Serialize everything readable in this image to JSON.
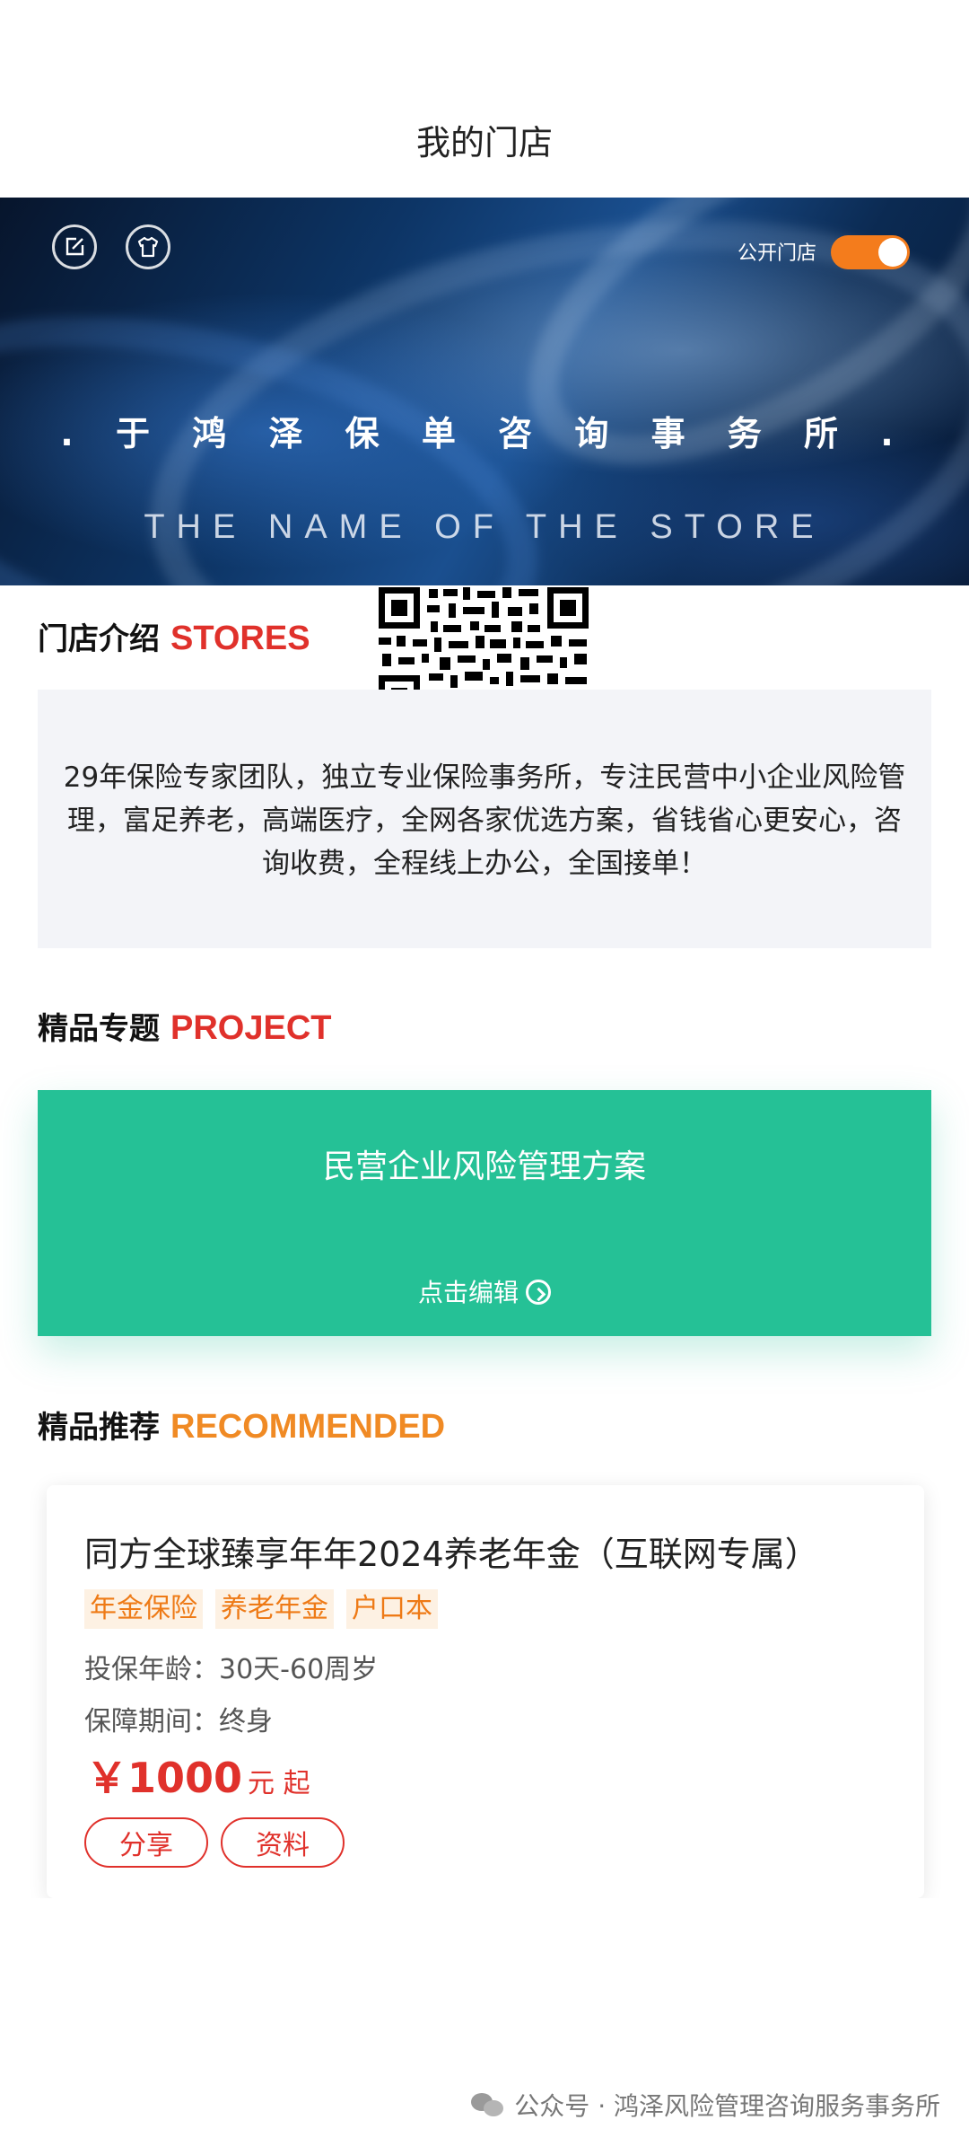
{
  "header": {
    "title": "我的门店"
  },
  "banner": {
    "public_label": "公开门店",
    "public_enabled": true,
    "store_name": ". 于 鸿 泽 保 单 咨 询 事 务 所 .",
    "store_subtitle": "THE NAME OF THE STORE"
  },
  "stores_section": {
    "title_cn": "门店介绍",
    "title_en": "STORES",
    "intro": "29年保险专家团队，独立专业保险事务所，专注民营中小企业风险管理，富足养老，高端医疗，全网各家优选方案，省钱省心更安心，咨询收费，全程线上办公，全国接单！"
  },
  "project_section": {
    "title_cn": "精品专题",
    "title_en": "PROJECT",
    "card_title": "民营企业风险管理方案",
    "card_action": "点击编辑"
  },
  "recommended_section": {
    "title_cn": "精品推荐",
    "title_en": "RECOMMENDED",
    "product": {
      "name": "同方全球臻享年年2024养老年金（互联网专属）",
      "tags": [
        "年金保险",
        "养老年金",
        "户口本"
      ],
      "age": "投保年龄：30天-60周岁",
      "period": "保障期间：终身",
      "price": "￥1000",
      "price_unit": "元 起",
      "share_label": "分享",
      "info_label": "资料"
    }
  },
  "watermark": "公众号 · 鸿泽风险管理咨询服务事务所",
  "colors": {
    "accent_red": "#e0312b",
    "accent_orange": "#f08a24",
    "toggle_orange": "#f47c1c",
    "project_green": "#25c196"
  }
}
